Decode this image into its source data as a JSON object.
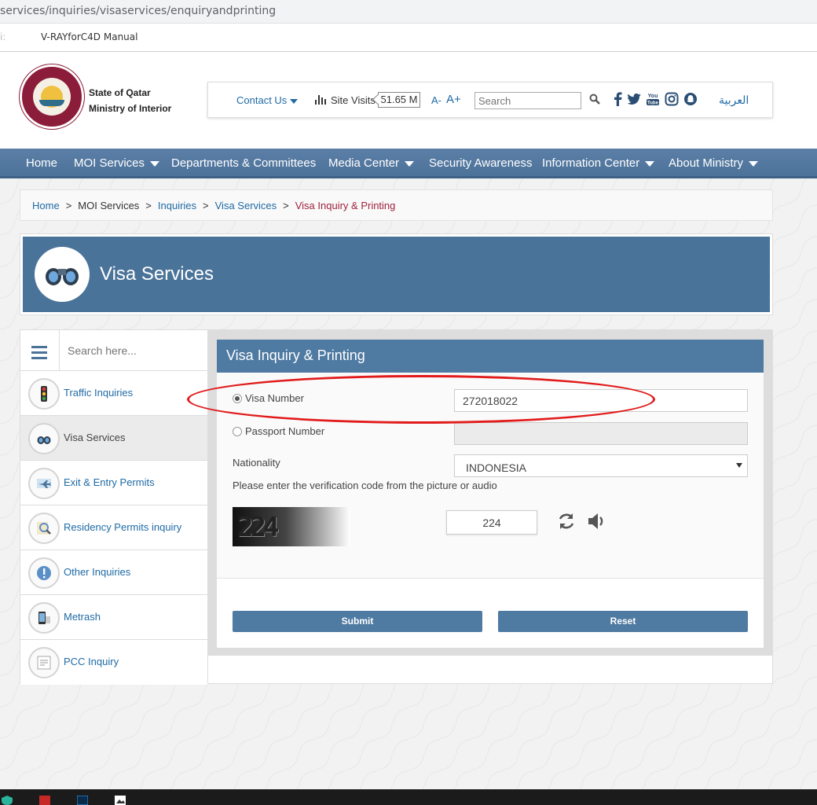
{
  "browser": {
    "url": "services/inquiries/visaservices/enquiryandprinting",
    "bookmark_partial": "i:",
    "bookmark": "V-RAYforC4D Manual"
  },
  "header": {
    "logo_line1": "State of Qatar",
    "logo_line2": "Ministry of Interior",
    "contact_us": "Contact Us",
    "site_visits_label": "Site Visits",
    "site_visits_value": "51.65 M",
    "font_decrease": "A-",
    "font_increase": "A+",
    "search_placeholder": "Search",
    "language": "العربية",
    "social_icons": [
      "facebook-icon",
      "twitter-icon",
      "youtube-icon",
      "instagram-icon",
      "snapchat-icon"
    ]
  },
  "nav": {
    "items": [
      {
        "label": "Home",
        "dropdown": false
      },
      {
        "label": "MOI Services",
        "dropdown": true
      },
      {
        "label": "Departments & Committees",
        "dropdown": false
      },
      {
        "label": "Media Center",
        "dropdown": true
      },
      {
        "label": "Security Awareness",
        "dropdown": false
      },
      {
        "label": "Information Center",
        "dropdown": true
      },
      {
        "label": "About Ministry",
        "dropdown": true
      }
    ]
  },
  "breadcrumb": {
    "items": [
      "Home",
      "MOI Services",
      "Inquiries",
      "Visa Services",
      "Visa Inquiry & Printing"
    ],
    "separator": ">"
  },
  "banner": {
    "title": "Visa Services"
  },
  "sidebar": {
    "search_placeholder": "Search here...",
    "items": [
      {
        "label": "Traffic Inquiries",
        "icon": "traffic-light-icon"
      },
      {
        "label": "Visa Services",
        "icon": "binoculars-icon"
      },
      {
        "label": "Exit & Entry Permits",
        "icon": "airplane-icon"
      },
      {
        "label": "Residency Permits inquiry",
        "icon": "magnifier-icon"
      },
      {
        "label": "Other Inquiries",
        "icon": "exclamation-icon"
      },
      {
        "label": "Metrash",
        "icon": "phone-icon"
      },
      {
        "label": "PCC Inquiry",
        "icon": "certificate-icon"
      }
    ]
  },
  "form": {
    "title": "Visa Inquiry & Printing",
    "visa_number_label": "Visa Number",
    "visa_number_value": "272018022",
    "passport_number_label": "Passport Number",
    "passport_number_value": "",
    "nationality_label": "Nationality",
    "nationality_value": "INDONESIA",
    "verification_text": "Please enter the verification code from the picture or audio",
    "captcha_code": "224",
    "captcha_input_value": "224",
    "submit_label": "Submit",
    "reset_label": "Reset",
    "selected_option": "Visa Number"
  },
  "colors": {
    "nav_bg": "#4d729a",
    "banner_bg": "#4a7399",
    "form_header_bg": "#4f7aa2",
    "link": "#1f6aa5",
    "current_crumb": "#a0233f",
    "annotation": "#e11b1b"
  }
}
